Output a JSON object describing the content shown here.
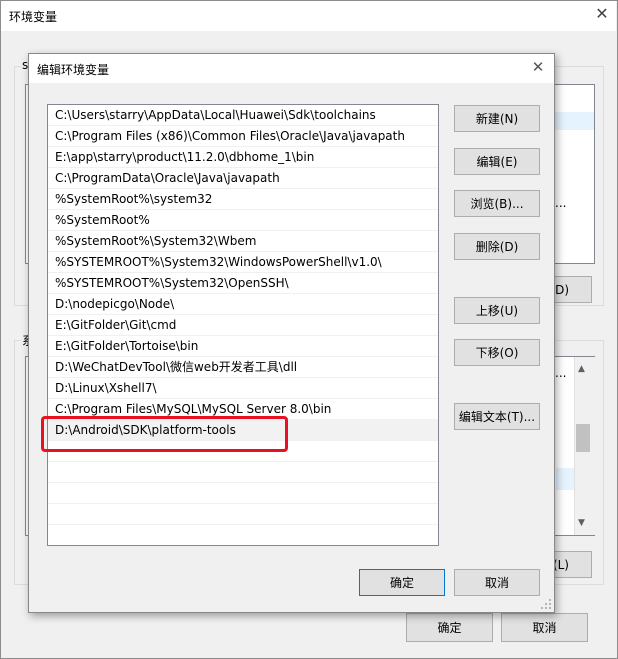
{
  "outer_window": {
    "title": "环境变量",
    "group_label_top_fragment": "s",
    "group_label_bottom_fragment": "系",
    "right_button_top_fragment": "(D)",
    "right_button_bottom_fragment": "(L)",
    "list_fragment_1": "...",
    "list_fragment_2": "...",
    "list_fragment_3": "...",
    "ok_label": "确定",
    "cancel_label": "取消"
  },
  "dialog": {
    "title": "编辑环境变量",
    "paths": [
      "C:\\Users\\starry\\AppData\\Local\\Huawei\\Sdk\\toolchains",
      "C:\\Program Files (x86)\\Common Files\\Oracle\\Java\\javapath",
      "E:\\app\\starry\\product\\11.2.0\\dbhome_1\\bin",
      "C:\\ProgramData\\Oracle\\Java\\javapath",
      "%SystemRoot%\\system32",
      "%SystemRoot%",
      "%SystemRoot%\\System32\\Wbem",
      "%SYSTEMROOT%\\System32\\WindowsPowerShell\\v1.0\\",
      "%SYSTEMROOT%\\System32\\OpenSSH\\",
      "D:\\nodepicgo\\Node\\",
      "E:\\GitFolder\\Git\\cmd",
      "E:\\GitFolder\\Tortoise\\bin",
      "D:\\WeChatDevTool\\微信web开发者工具\\dll",
      "D:\\Linux\\Xshell7\\",
      "C:\\Program Files\\MySQL\\MySQL Server 8.0\\bin",
      "D:\\Android\\SDK\\platform-tools"
    ],
    "selected_index": 15,
    "buttons": {
      "new": "新建(N)",
      "edit": "编辑(E)",
      "browse": "浏览(B)...",
      "delete": "删除(D)",
      "move_up": "上移(U)",
      "move_down": "下移(O)",
      "edit_text": "编辑文本(T)...",
      "ok": "确定",
      "cancel": "取消"
    }
  },
  "colors": {
    "highlight": "#e81123",
    "focus_border": "#0078d7"
  }
}
